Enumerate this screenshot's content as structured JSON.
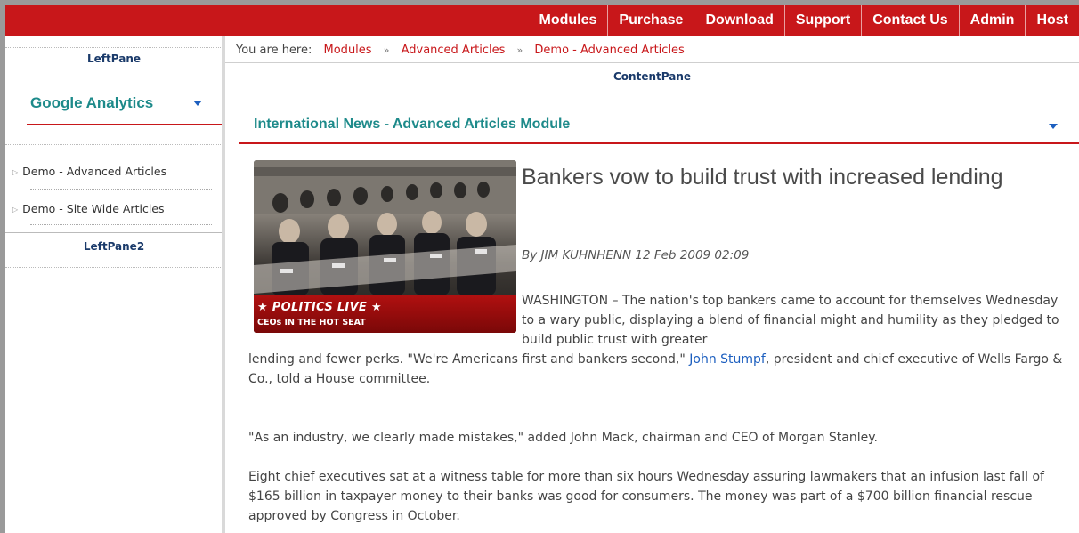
{
  "topnav": {
    "items": [
      "Modules",
      "Purchase",
      "Download",
      "Support",
      "Contact Us",
      "Admin",
      "Host"
    ]
  },
  "left_pane": {
    "label": "LeftPane",
    "module_title": "Google Analytics",
    "links": [
      "Demo - Advanced Articles",
      "Demo - Site Wide Articles"
    ],
    "label2": "LeftPane2"
  },
  "breadcrumb": {
    "prefix": "You are here:",
    "items": [
      "Modules",
      "Advanced Articles",
      "Demo - Advanced Articles"
    ],
    "separator": "»"
  },
  "content_pane": {
    "label": "ContentPane",
    "module_title": "International News - Advanced Articles Module"
  },
  "article": {
    "image_banner_title": "★ POLITICS LIVE ★",
    "image_banner_subtitle": "CEOs IN THE HOT SEAT",
    "title": "Bankers vow to build trust with increased lending",
    "byline": "By JIM KUHNHENN 12 Feb 2009 02:09",
    "para1_top": "WASHINGTON – The nation's top bankers came to account for themselves Wednesday to a wary public, displaying a blend of financial might and humility as they pledged to build public trust with greater",
    "para1_rest_before": "lending and fewer perks. \"We're Americans first and bankers second,\" ",
    "para1_link": "John Stumpf",
    "para1_rest_after": ", president and chief executive of Wells Fargo & Co., told a House committee.",
    "para2": "\"As an industry, we clearly made mistakes,\" added John Mack, chairman and CEO of Morgan Stanley.",
    "para3": "Eight chief executives sat at a witness table for more than six hours Wednesday assuring lawmakers that an infusion last fall of $165 billion in taxpayer money to their banks was good for consumers. The money was part of a $700 billion financial rescue approved by Congress in October."
  },
  "colors": {
    "nav_red": "#c8171a",
    "teal_heading": "#1d8a8a",
    "link_blue": "#1d5fbf"
  }
}
